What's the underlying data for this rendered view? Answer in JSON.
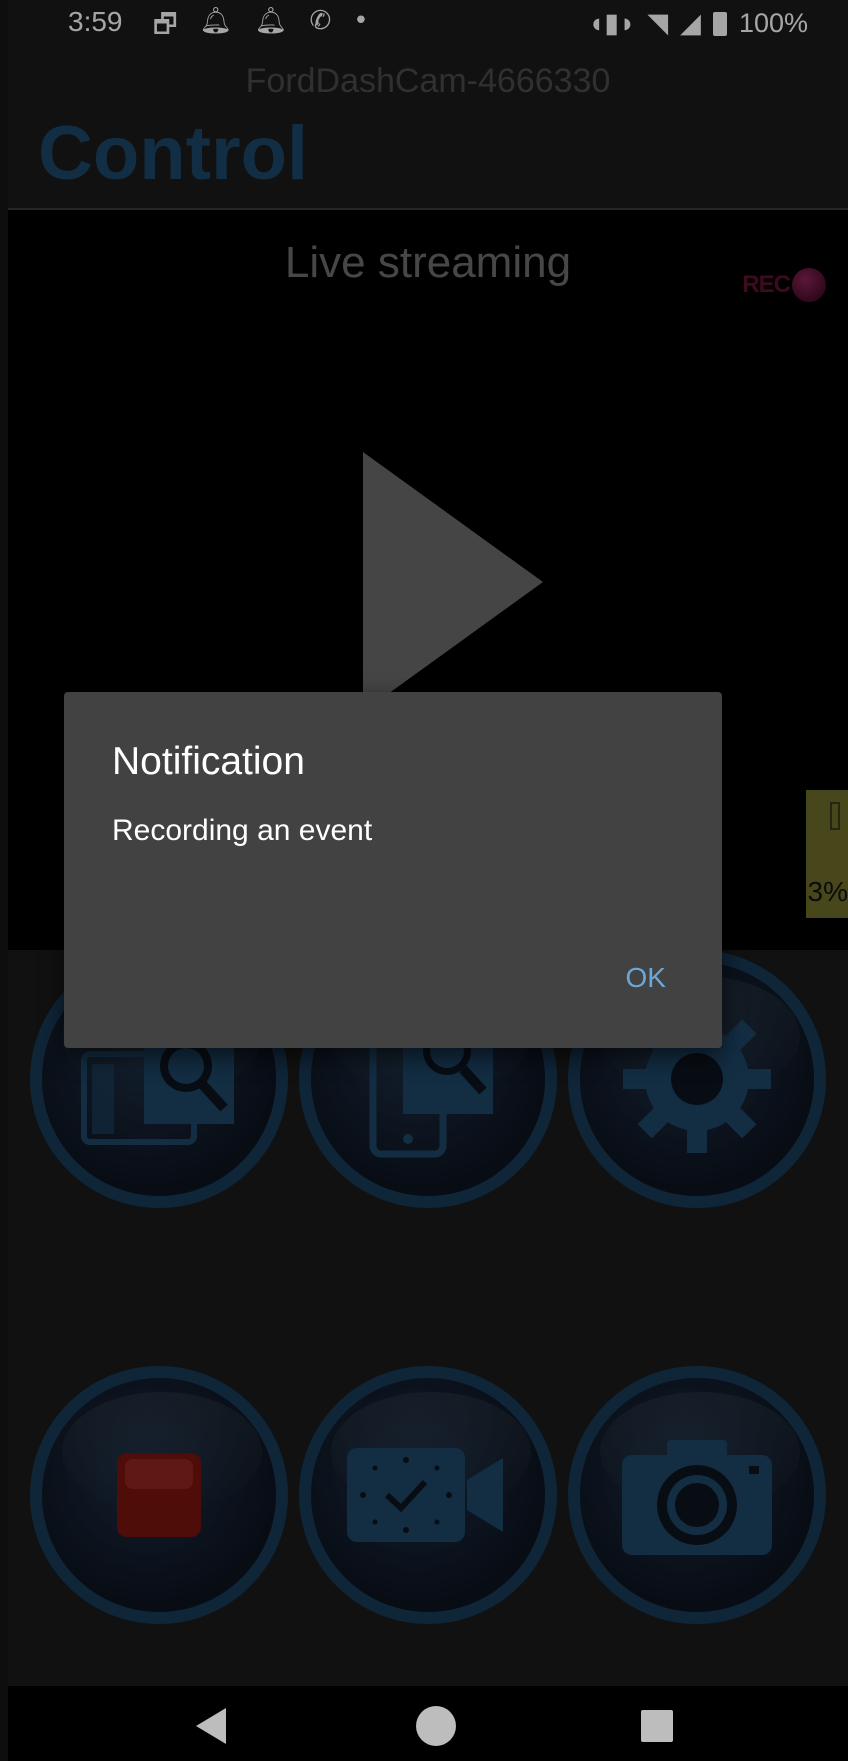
{
  "status_bar": {
    "time": "3:59",
    "battery_text": "100%",
    "icons": [
      "image-icon",
      "bell-icon",
      "bell-icon",
      "missed-call-icon",
      "dot-icon",
      "vibrate-icon",
      "wifi-icon",
      "signal-icon",
      "battery-icon"
    ]
  },
  "header": {
    "device_name": "FordDashCam-4666330",
    "title": "Control"
  },
  "video": {
    "live_label": "Live streaming",
    "rec_label": "REC",
    "storage_percent": "3%"
  },
  "controls": [
    {
      "name": "sd-card-browse",
      "icon": "sd-card-search-icon"
    },
    {
      "name": "phone-browse",
      "icon": "phone-search-icon"
    },
    {
      "name": "settings",
      "icon": "gear-icon"
    },
    {
      "name": "stop-recording",
      "icon": "stop-icon"
    },
    {
      "name": "event-recording",
      "icon": "video-clock-icon"
    },
    {
      "name": "take-photo",
      "icon": "camera-icon"
    }
  ],
  "dialog": {
    "title": "Notification",
    "message": "Recording an event",
    "ok_label": "OK"
  },
  "colors": {
    "accent": "#173956",
    "title": "#1c4869",
    "dialog_bg": "#424242",
    "ok_text": "#6ba8d8",
    "rec_dot": "#8a2656"
  }
}
